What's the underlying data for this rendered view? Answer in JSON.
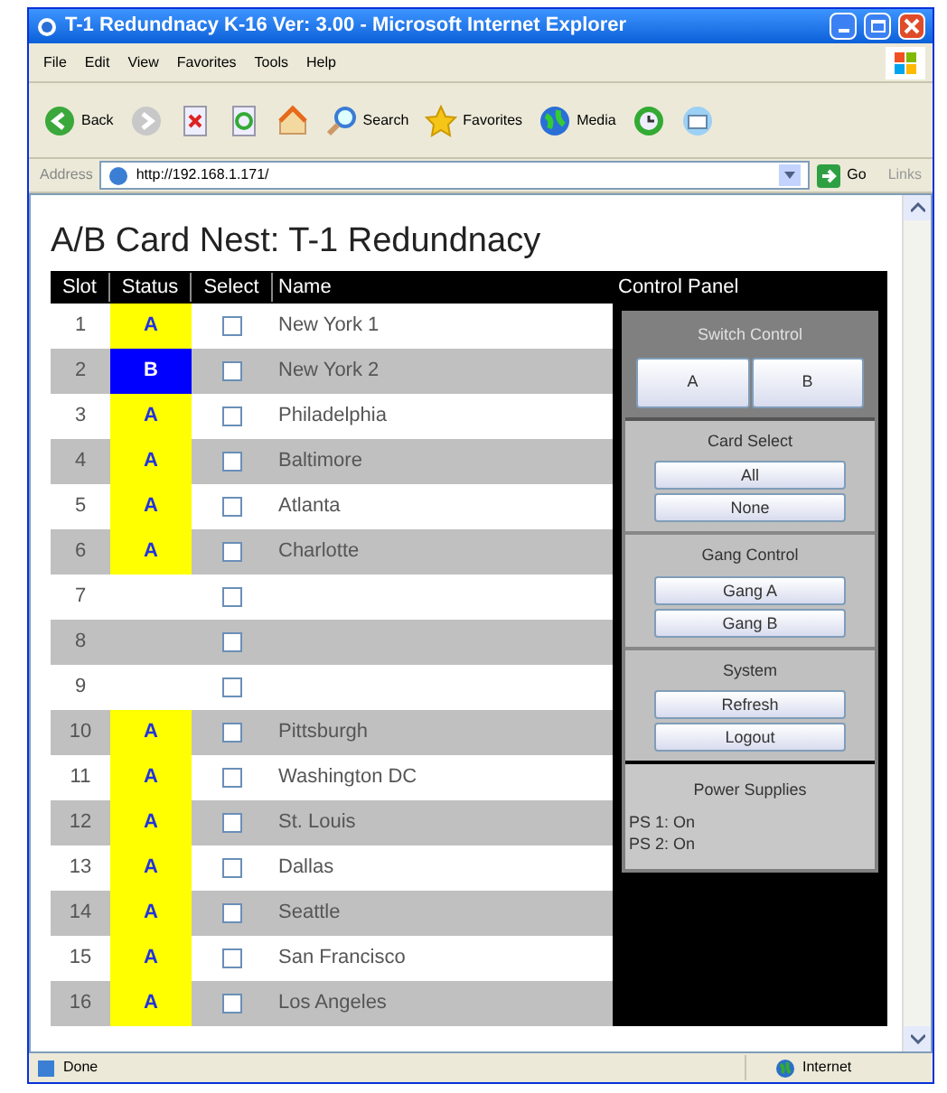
{
  "window": {
    "title": "T-1 Redundnacy K-16 Ver: 3.00 - Microsoft Internet Explorer"
  },
  "menu": [
    "File",
    "Edit",
    "View",
    "Favorites",
    "Tools",
    "Help"
  ],
  "toolbar": [
    {
      "kind": "back",
      "label": "Back"
    },
    {
      "kind": "forward"
    },
    {
      "kind": "stop"
    },
    {
      "kind": "refresh"
    },
    {
      "kind": "home"
    },
    {
      "kind": "search",
      "label": "Search"
    },
    {
      "kind": "favorites",
      "label": "Favorites"
    },
    {
      "kind": "media",
      "label": "Media"
    },
    {
      "kind": "history"
    },
    {
      "kind": "mail"
    }
  ],
  "address_bar": {
    "label": "Address",
    "url": "http://192.168.1.171/",
    "go": "Go",
    "links": "Links"
  },
  "page": {
    "heading": "A/B Card Nest: T-1 Redundnacy",
    "columns": [
      "Slot",
      "Status",
      "Select",
      "Name"
    ],
    "rows": [
      {
        "slot": "1",
        "status": "A",
        "color": "#ffff00",
        "checked": false,
        "name": "New York 1"
      },
      {
        "slot": "2",
        "status": "B",
        "color": "#0000ff",
        "checked": false,
        "name": "New York 2"
      },
      {
        "slot": "3",
        "status": "A",
        "color": "#ffff00",
        "checked": false,
        "name": "Philadelphia"
      },
      {
        "slot": "4",
        "status": "A",
        "color": "#ffff00",
        "checked": false,
        "name": "Baltimore"
      },
      {
        "slot": "5",
        "status": "A",
        "color": "#ffff00",
        "checked": false,
        "name": "Atlanta"
      },
      {
        "slot": "6",
        "status": "A",
        "color": "#ffff00",
        "checked": false,
        "name": "Charlotte"
      },
      {
        "slot": "7",
        "checked": false
      },
      {
        "slot": "8",
        "checked": false
      },
      {
        "slot": "9",
        "checked": false
      },
      {
        "slot": "10",
        "status": "A",
        "color": "#ffff00",
        "checked": false,
        "name": "Pittsburgh"
      },
      {
        "slot": "11",
        "status": "A",
        "color": "#ffff00",
        "checked": false,
        "name": "Washington DC"
      },
      {
        "slot": "12",
        "status": "A",
        "color": "#ffff00",
        "checked": false,
        "name": "St. Louis"
      },
      {
        "slot": "13",
        "status": "A",
        "color": "#ffff00",
        "checked": false,
        "name": "Dallas"
      },
      {
        "slot": "14",
        "status": "A",
        "color": "#ffff00",
        "checked": false,
        "name": "Seattle"
      },
      {
        "slot": "15",
        "status": "A",
        "color": "#ffff00",
        "checked": false,
        "name": "San Francisco"
      },
      {
        "slot": "16",
        "status": "A",
        "color": "#ffff00",
        "checked": false,
        "name": "Los Angeles"
      }
    ]
  },
  "control_panel": {
    "title": "Control Panel",
    "sections": [
      {
        "kind": "switch",
        "title": "Switch Control",
        "buttons": [
          "A",
          "B"
        ]
      },
      {
        "kind": "list",
        "title": "Card Select",
        "buttons": [
          "All",
          "None"
        ]
      },
      {
        "kind": "list",
        "title": "Gang Control",
        "buttons": [
          "Gang A",
          "Gang B"
        ]
      },
      {
        "kind": "list",
        "title": "System",
        "buttons": [
          "Refresh",
          "Logout"
        ]
      },
      {
        "kind": "info",
        "title": "Power Supplies",
        "lines": [
          "PS 1: On",
          "PS 2: On"
        ]
      }
    ]
  },
  "status_bar": {
    "left": "Done",
    "right": "Internet"
  }
}
